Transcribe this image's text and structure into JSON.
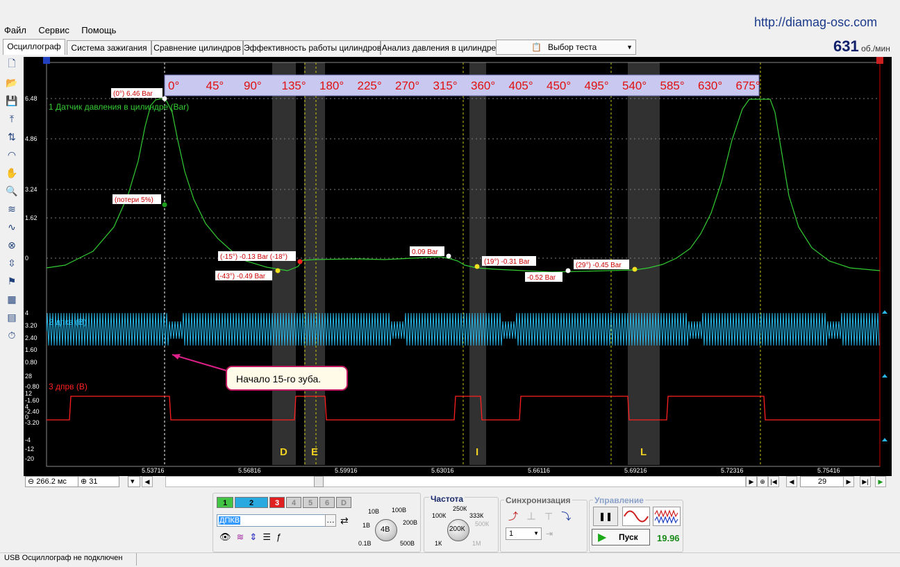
{
  "site_url": "http://diamag-osc.com",
  "menu": [
    "Файл",
    "Сервис",
    "Помощь"
  ],
  "tabs": [
    "Осциллограф",
    "Система зажигания",
    "Сравнение цилиндров",
    "Эффективность работы цилиндров",
    "Анализ давления в цилиндре"
  ],
  "test_select": "Выбор теста",
  "rpm": {
    "value": "631",
    "unit": "об./мин"
  },
  "toolbar_icons": [
    "new-file-icon",
    "open-folder-icon",
    "save-icon",
    "auto-scale-icon",
    "cursor-measure-icon",
    "pressure-analysis-icon",
    "hand-pan-icon",
    "zoom-icon",
    "filter-icon",
    "waveform-icon",
    "marker-icon",
    "align-icon",
    "color-settings-icon",
    "screen-split-icon",
    "table-icon",
    "auto-time-icon"
  ],
  "plot": {
    "angle_scale": [
      "0°",
      "45°",
      "90°",
      "135°",
      "180°",
      "225°",
      "270°",
      "315°",
      "360°",
      "405°",
      "450°",
      "495°",
      "540°",
      "585°",
      "630°",
      "675°"
    ],
    "y_axis_1": [
      "6.48",
      "4.86",
      "3.24",
      "1.62",
      "0"
    ],
    "y_axis_2": [
      "4",
      "3.20",
      "2.40",
      "1.60",
      "0.80"
    ],
    "y_axis_3": [
      "28",
      "-0.80",
      "12",
      "-1.60",
      "4",
      "-2.40",
      "0",
      "-3.20",
      "-4",
      "-12",
      "-20"
    ],
    "x_axis": [
      "5.53716",
      "5.56816",
      "5.59916",
      "5.63016",
      "5.66116",
      "5.69216",
      "5.72316",
      "5.75416"
    ],
    "ch1_label": "1 Датчик давления в цилиндре (Bar)",
    "ch2_label": "2 дпкв (В)",
    "ch3_label": "3 дпрв (В)",
    "markers": [
      "D",
      "E",
      "I",
      "L"
    ],
    "annotations": {
      "peak": "(0°) 6.46 Bar",
      "loss": "(потери 5%)",
      "a15": "(-15°) -0.13 Bar (-18°)",
      "a43": "(-43°) -0.49 Bar",
      "p009": "0.09 Bar",
      "a19": "(19°) -0.31 Bar",
      "m052": "-0.52 Bar",
      "a29": "(29°) -0.45 Bar"
    },
    "callout": "Начало 15-го зуба."
  },
  "timebase": {
    "value": "266.2 мс",
    "count": "31"
  },
  "frame_number": "29",
  "channels": {
    "buttons": [
      "1",
      "2",
      "3",
      "4",
      "5",
      "6",
      "D"
    ],
    "active_name": "ДПКВ"
  },
  "voltage": {
    "labels": [
      "10В",
      "100В",
      "1В",
      "200В",
      "0.1В",
      "500В"
    ],
    "knob": "4В"
  },
  "frequency": {
    "title": "Частота",
    "labels": [
      "250К",
      "100К",
      "333К",
      "500К",
      "1К",
      "1М"
    ],
    "knob": "200К"
  },
  "sync": {
    "title": "Синхронизация",
    "value": "1"
  },
  "control": {
    "title": "Управление",
    "start": "Пуск",
    "fps": "19.96"
  },
  "status": "USB Осциллограф не подключен",
  "colors": {
    "ch1": "#33cc33",
    "ch2": "#29b6e8",
    "ch3": "#ff2020",
    "grid": "#c8c800",
    "bg": "#000000",
    "label_red": "#cc0000"
  }
}
